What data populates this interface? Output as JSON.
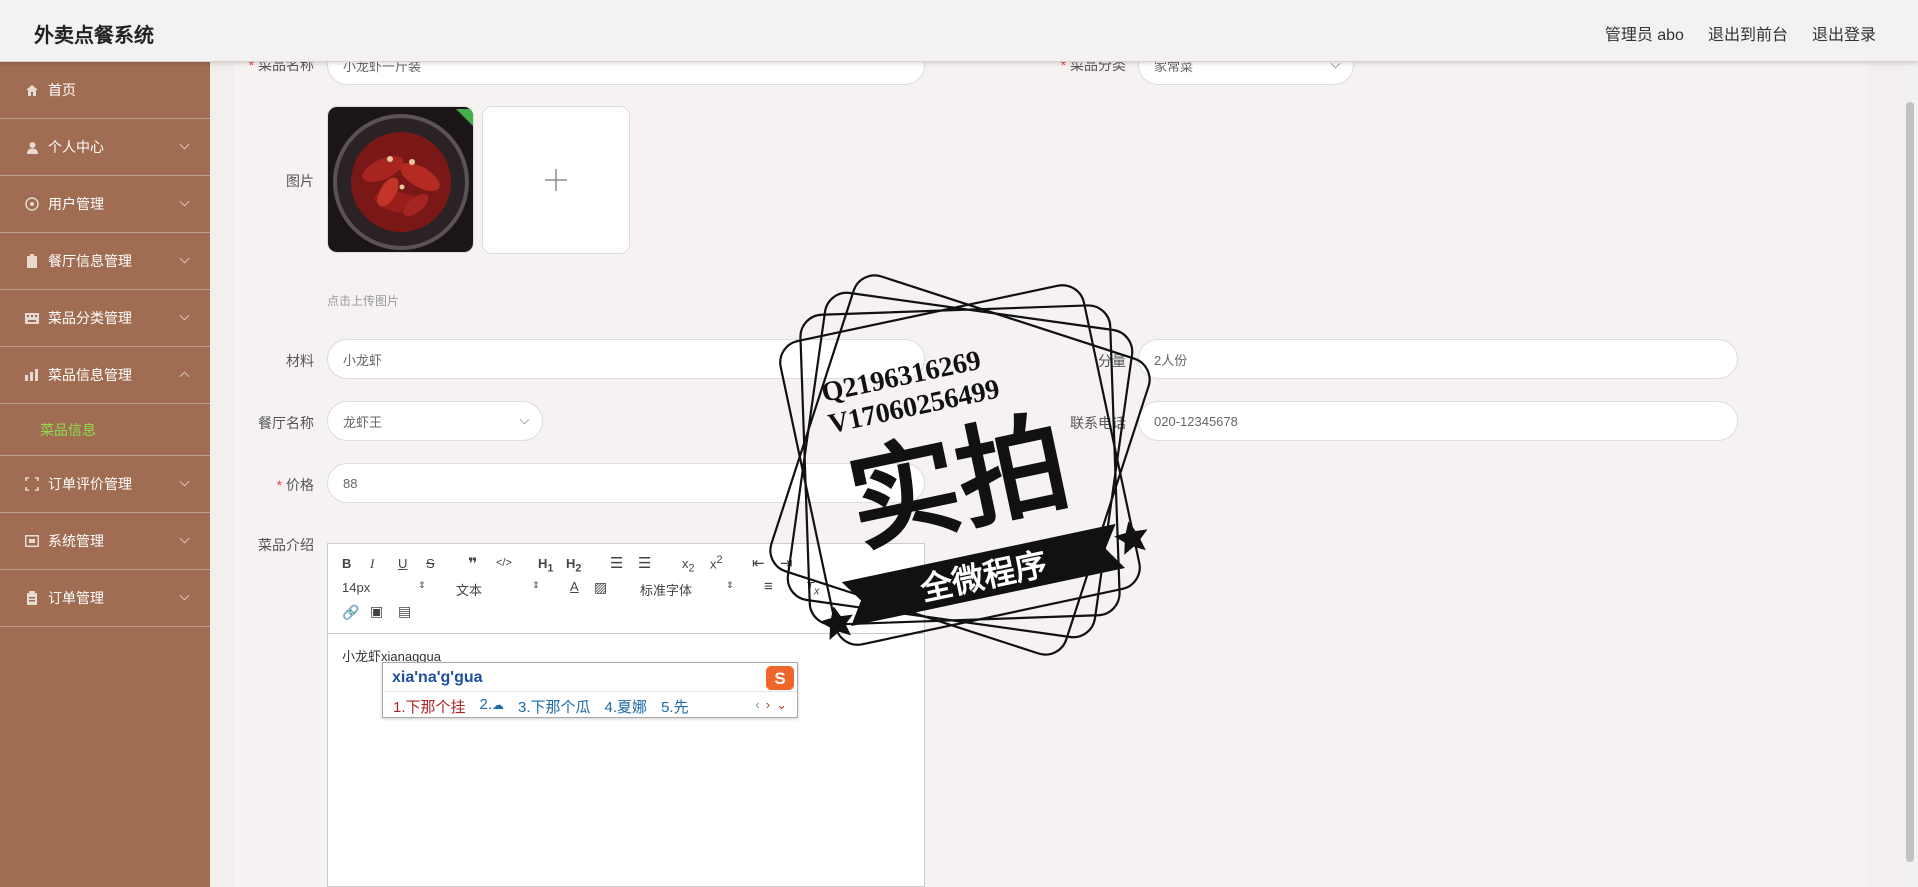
{
  "header": {
    "title": "外卖点餐系统",
    "admin": "管理员 abo",
    "to_front": "退出到前台",
    "logout": "退出登录"
  },
  "sidebar": {
    "items": [
      {
        "label": "首页",
        "icon": "home-icon"
      },
      {
        "label": "个人中心",
        "icon": "user-icon"
      },
      {
        "label": "用户管理",
        "icon": "users-icon"
      },
      {
        "label": "餐厅信息管理",
        "icon": "clipboard-icon"
      },
      {
        "label": "菜品分类管理",
        "icon": "keyboard-icon"
      },
      {
        "label": "菜品信息管理",
        "icon": "chart-icon"
      },
      {
        "label": "订单评价管理",
        "icon": "scan-icon"
      },
      {
        "label": "系统管理",
        "icon": "monitor-icon"
      },
      {
        "label": "订单管理",
        "icon": "document-icon"
      }
    ],
    "active_sub": "菜品信息"
  },
  "form": {
    "dish_name_label": "菜品名称",
    "dish_name_value": "小龙虾一斤装",
    "category_label": "菜品分类",
    "category_value": "家常菜",
    "image_label": "图片",
    "upload_hint": "点击上传图片",
    "material_label": "材料",
    "material_value": "小龙虾",
    "portion_label": "分量",
    "portion_value": "2人份",
    "restaurant_label": "餐厅名称",
    "restaurant_value": "龙虾王",
    "phone_label": "联系电话",
    "phone_value": "020-12345678",
    "price_label": "价格",
    "price_value": "88",
    "intro_label": "菜品介绍"
  },
  "editor": {
    "toolbar_row2": {
      "font_size": "14px",
      "text_type": "文本",
      "font_family": "标准字体"
    },
    "content": "小龙虾xianaggua"
  },
  "ime": {
    "input": "xia'na'g'gua",
    "candidates": [
      "1.下那个挂",
      "2.",
      "3.下那个瓜",
      "4.夏娜",
      "5.先"
    ]
  },
  "watermark": {
    "line1": "Q2196316269",
    "line2": "V17060256499",
    "main": "实拍",
    "banner": "全微程序"
  }
}
